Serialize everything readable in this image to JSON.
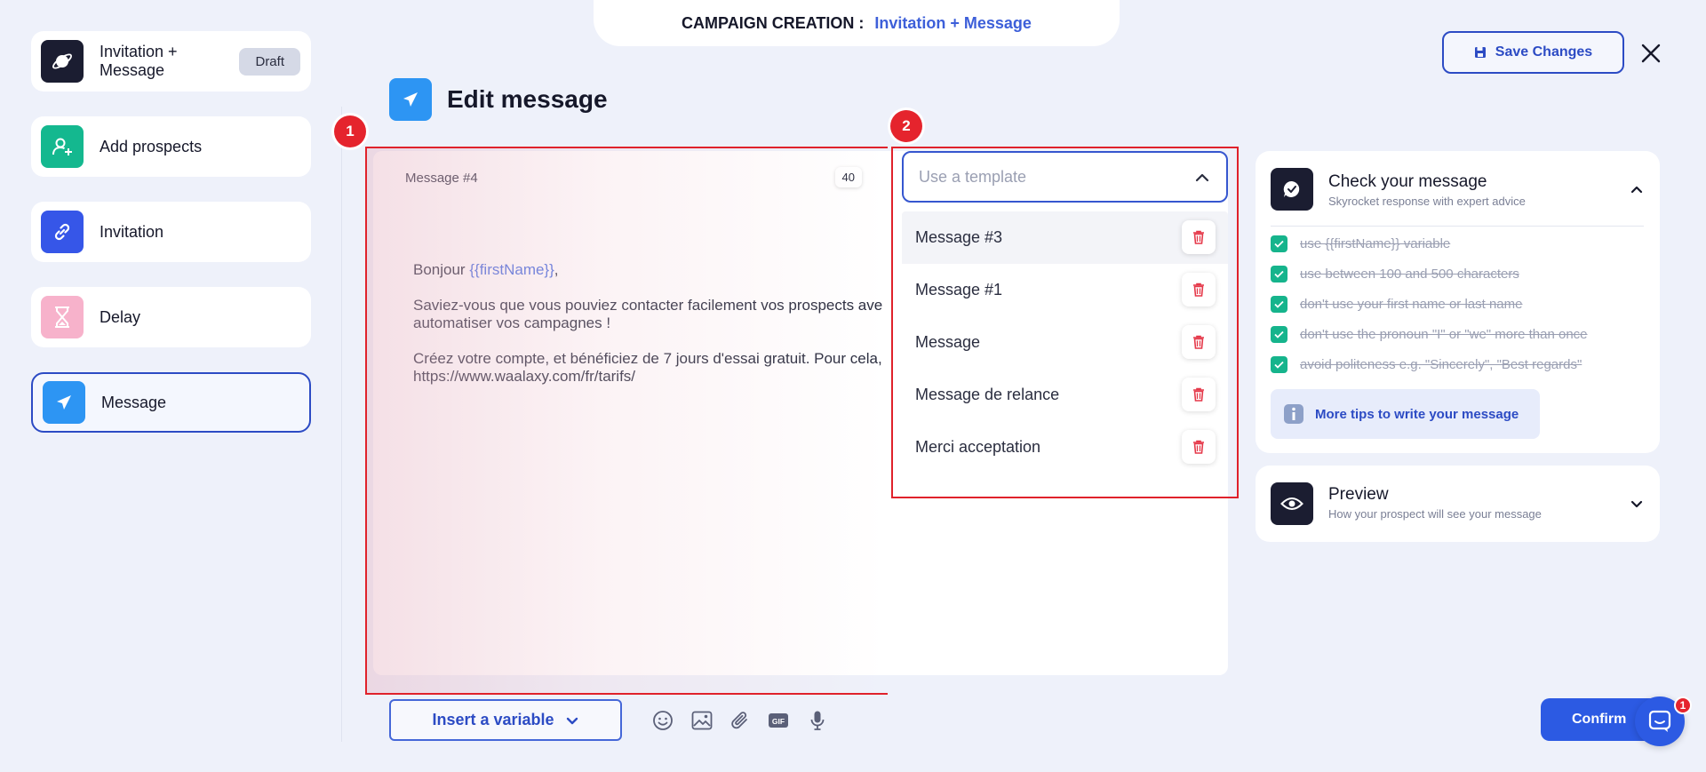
{
  "header": {
    "prefix": "CAMPAIGN CREATION :",
    "campaign_name": "Invitation + Message"
  },
  "save_button": {
    "label": "Save Changes",
    "icon": "floppy-icon"
  },
  "close_icon": "close-icon",
  "sidebar": {
    "items": [
      {
        "label": "Invitation + Message",
        "badge": "Draft",
        "icon": "planet-icon",
        "color": "#1b1d31"
      },
      {
        "label": "Add prospects",
        "icon": "add-user-icon",
        "color": "#14b88f"
      },
      {
        "label": "Invitation",
        "icon": "link-icon",
        "color": "#3656e8"
      },
      {
        "label": "Delay",
        "icon": "hourglass-icon",
        "color": "#f7b2cb"
      },
      {
        "label": "Message",
        "icon": "paper-plane-icon",
        "color": "#2d95f3",
        "active": true
      }
    ]
  },
  "page": {
    "title": "Edit message"
  },
  "annotations": [
    "1",
    "2"
  ],
  "editor": {
    "message_name": "Message #4",
    "char_count": "40",
    "greeting": "Bonjour",
    "variable": "{{firstName}}",
    "greeting_end": ",",
    "paragraph_2": "Saviez-vous que vous pouviez contacter facilement vos prospects ave automatiser vos campagnes !",
    "paragraph_3": "Créez votre compte, et bénéficiez de 7 jours d'essai gratuit. Pour cela, https://www.waalaxy.com/fr/tarifs/"
  },
  "template": {
    "placeholder": "Use a template",
    "options": [
      "Message #3",
      "Message #1",
      "Message",
      "Message de relance",
      "Merci acceptation"
    ]
  },
  "toolbar": {
    "insert_variable": "Insert a variable",
    "icons": [
      "emoji-icon",
      "image-icon",
      "attachment-icon",
      "gif-icon",
      "microphone-icon"
    ],
    "gif_label": "GIF"
  },
  "check_card": {
    "title": "Check your message",
    "subtitle": "Skyrocket response with expert advice",
    "checks": [
      "use {{firstName}} variable",
      "use between 100 and 500 characters",
      "don't use your first name or last name",
      "don't use the pronoun \"I\" or \"we\" more than once",
      "avoid politeness e.g. \"Sincerely\", \"Best regards\""
    ],
    "tips_label": "More tips to write your message"
  },
  "preview_card": {
    "title": "Preview",
    "subtitle": "How your prospect will see your message"
  },
  "confirm_button": {
    "label": "Confirm"
  },
  "chat": {
    "badge": "1"
  },
  "colors": {
    "accent": "#2c4bc4",
    "highlight": "#e0222b",
    "success": "#16b48c"
  }
}
